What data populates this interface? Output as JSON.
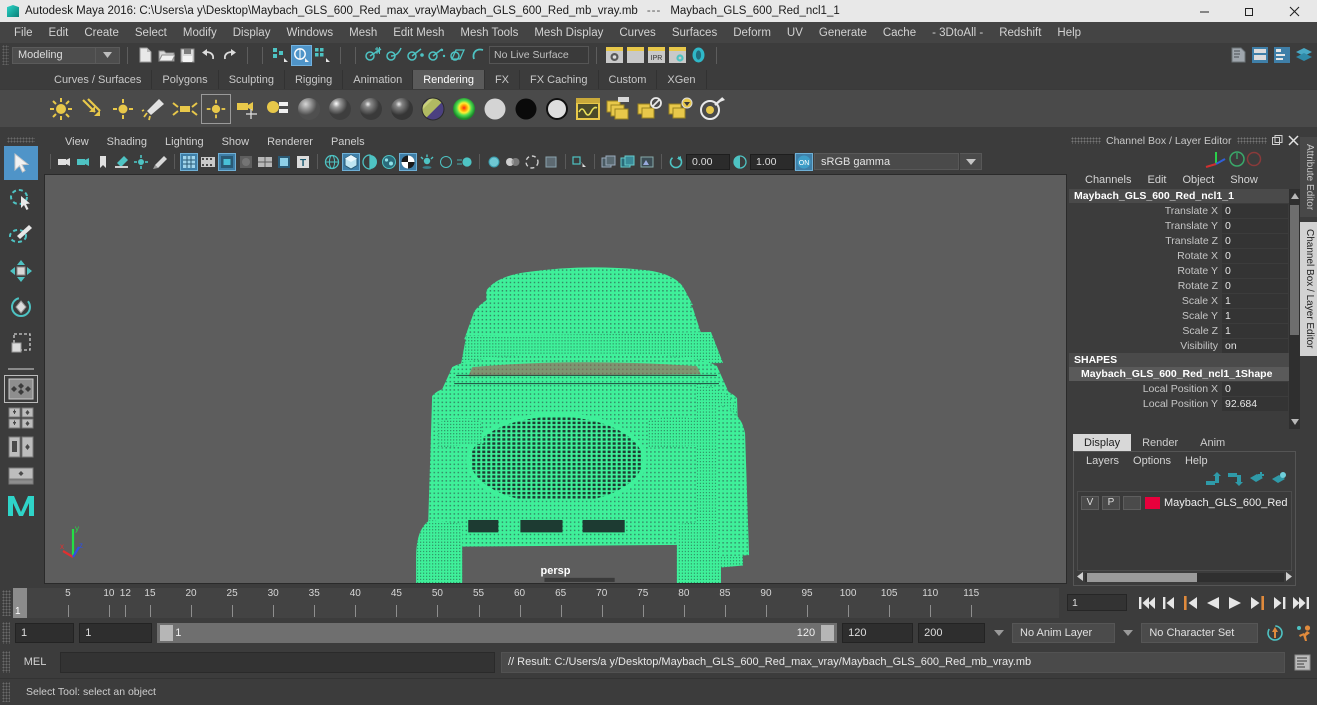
{
  "window": {
    "app_title": "Autodesk Maya 2016: C:\\Users\\a y\\Desktop\\Maybach_GLS_600_Red_max_vray\\Maybach_GLS_600_Red_mb_vray.mb",
    "title_separator": "---",
    "selected_object_title": "Maybach_GLS_600_Red_ncl1_1",
    "minimize": "minimize-icon",
    "maximize": "restore-icon",
    "close": "close-icon"
  },
  "menubar": {
    "items": [
      "File",
      "Edit",
      "Create",
      "Select",
      "Modify",
      "Display",
      "Windows",
      "Mesh",
      "Edit Mesh",
      "Mesh Tools",
      "Mesh Display",
      "Curves",
      "Surfaces",
      "Deform",
      "UV",
      "Generate",
      "Cache",
      "- 3DtoAll -",
      "Redshift",
      "Help"
    ]
  },
  "statusline": {
    "menu_set": "Modeling",
    "live_surface": "No Live Surface",
    "icons": [
      "new-scene-icon",
      "open-scene-icon",
      "save-scene-icon",
      "undo-icon",
      "redo-icon",
      "select-by-hierarchy-icon",
      "select-by-object-icon",
      "select-by-component-icon",
      "snap-to-grid-icon",
      "snap-to-curve-icon",
      "snap-to-point-icon",
      "snap-to-projected-center-icon",
      "snap-to-view-plane-icon",
      "make-live-icon",
      "render-view-icon",
      "render-frame-icon",
      "ipr-render-icon",
      "render-settings-icon",
      "hypershade-icon"
    ],
    "right_icons": [
      "toggle-attribute-editor-icon",
      "toggle-tool-settings-icon",
      "toggle-channel-box-icon",
      "toggle-layer-editor-icon"
    ]
  },
  "shelf": {
    "tabs": [
      "Curves / Surfaces",
      "Polygons",
      "Sculpting",
      "Rigging",
      "Animation",
      "Rendering",
      "FX",
      "FX Caching",
      "Custom",
      "XGen"
    ],
    "active_tab": "Rendering",
    "icons": [
      "ambient-light-icon",
      "directional-light-icon",
      "point-light-icon",
      "spot-light-icon",
      "area-light-icon",
      "volume-light-icon",
      "camera-icon",
      "light-linking-icon",
      "lambert-material-icon",
      "blinn-material-icon",
      "phong-material-icon",
      "phong-e-material-icon",
      "anisotropic-material-icon",
      "layered-shader-icon",
      "ramp-shader-icon",
      "surface-shader-icon",
      "use-background-icon",
      "shading-map-icon",
      "hypershade-window-icon",
      "batch-render-icon",
      "cancel-batch-render-icon",
      "show-batch-render-icon",
      "render-current-frame-icon"
    ]
  },
  "toolbox": {
    "items": [
      {
        "name": "select-tool",
        "selected": true
      },
      {
        "name": "lasso-select-tool",
        "selected": false
      },
      {
        "name": "paint-select-tool",
        "selected": false
      },
      {
        "name": "move-tool",
        "selected": false
      },
      {
        "name": "rotate-tool",
        "selected": false
      },
      {
        "name": "scale-tool",
        "selected": false
      }
    ],
    "layouts": [
      {
        "name": "single-perspective-layout",
        "selected": true
      },
      {
        "name": "four-view-layout",
        "selected": false
      },
      {
        "name": "persp-outliner-layout",
        "selected": false
      },
      {
        "name": "persp-graph-layout",
        "selected": false
      },
      {
        "name": "maya-logo",
        "selected": false
      }
    ]
  },
  "viewport": {
    "menu": [
      "View",
      "Shading",
      "Lighting",
      "Show",
      "Renderer",
      "Panels"
    ],
    "toolbar_icons": [
      "select-camera-icon",
      "lock-camera-icon",
      "bookmark-icon",
      "image-plane-icon",
      "2d-pan-zoom-icon",
      "grease-pencil-icon",
      "grid-icon",
      "film-gate-icon",
      "resolution-gate-icon",
      "gate-mask-icon",
      "field-chart-icon",
      "safe-action-icon",
      "safe-title-icon",
      "wireframe-icon",
      "smooth-shade-all-icon",
      "shade-selected-items-icon",
      "wireframe-on-shaded-icon",
      "texture-icon",
      "use-all-lights-icon",
      "shadows-icon",
      "screen-space-ao-icon",
      "motion-blur-icon",
      "multisample-aa-icon",
      "depth-of-field-icon",
      "isolate-select-icon",
      "xray-icon",
      "xray-joints-icon",
      "xray-active-components-icon",
      "exposure-icon",
      "gamma-icon",
      "view-transform-icon"
    ],
    "exposure_value": "0.00",
    "gamma_value": "1.00",
    "color_transform": "sRGB gamma",
    "camera_label": "persp",
    "axis_labels": {
      "x": "x",
      "y": "y",
      "z": "z"
    },
    "model_description": "maybach-gls-600-wireframe-car-model"
  },
  "channel_box": {
    "panel_title": "Channel Box / Layer Editor",
    "menu": [
      "Channels",
      "Edit",
      "Object",
      "Show"
    ],
    "object_name": "Maybach_GLS_600_Red_ncl1_1",
    "attributes": [
      {
        "label": "Translate X",
        "value": "0"
      },
      {
        "label": "Translate Y",
        "value": "0"
      },
      {
        "label": "Translate Z",
        "value": "0"
      },
      {
        "label": "Rotate X",
        "value": "0"
      },
      {
        "label": "Rotate Y",
        "value": "0"
      },
      {
        "label": "Rotate Z",
        "value": "0"
      },
      {
        "label": "Scale X",
        "value": "1"
      },
      {
        "label": "Scale Y",
        "value": "1"
      },
      {
        "label": "Scale Z",
        "value": "1"
      },
      {
        "label": "Visibility",
        "value": "on"
      }
    ],
    "shapes_header": "SHAPES",
    "shape_name": "Maybach_GLS_600_Red_ncl1_1Shape",
    "shape_attributes": [
      {
        "label": "Local Position X",
        "value": "0"
      },
      {
        "label": "Local Position Y",
        "value": "92.684"
      }
    ]
  },
  "layer_editor": {
    "tabs": [
      "Display",
      "Render",
      "Anim"
    ],
    "active_tab": "Display",
    "menu": [
      "Layers",
      "Options",
      "Help"
    ],
    "toolbar_icons": [
      "move-layer-up-icon",
      "move-layer-down-icon",
      "new-layer-icon",
      "new-layer-from-selected-icon"
    ],
    "layers": [
      {
        "visibility": "V",
        "playback": "P",
        "third": "",
        "color": "#e8003c",
        "name": "Maybach_GLS_600_Red"
      }
    ]
  },
  "timeline": {
    "current_frame": "1",
    "ticks": [
      "5",
      "10",
      "15",
      "20",
      "25",
      "30",
      "35",
      "40",
      "45",
      "50",
      "55",
      "60",
      "65",
      "70",
      "75",
      "80",
      "85",
      "90",
      "95",
      "100",
      "105",
      "110",
      "115",
      "12"
    ],
    "current_frame_field": "1",
    "playback_buttons": [
      "go-to-start-icon",
      "step-back-keyframe-icon",
      "step-back-frame-icon",
      "play-backwards-icon",
      "play-forwards-icon",
      "step-forward-frame-icon",
      "step-forward-keyframe-icon",
      "go-to-end-icon"
    ]
  },
  "range_slider": {
    "anim_start": "1",
    "playback_start": "1",
    "range_start_label": "1",
    "range_end_label": "120",
    "playback_end": "120",
    "anim_end": "200",
    "anim_layer": "No Anim Layer",
    "character_set": "No Character Set",
    "icons": [
      "auto-keyframe-icon",
      "animation-preferences-icon"
    ]
  },
  "command_line": {
    "label": "MEL",
    "input_value": "",
    "result_text": "// Result: C:/Users/a y/Desktop/Maybach_GLS_600_Red_max_vray/Maybach_GLS_600_Red_mb_vray.mb",
    "script_editor_icon": "script-editor-icon"
  },
  "status_bar": {
    "help_text": "Select Tool: select an object"
  },
  "colors": {
    "accent_blue": "#4f94c8",
    "selection_green": "#3ff09a",
    "layer_red": "#e8003c",
    "shelf_yellow": "#e8c84a",
    "teal": "#4ec3c3",
    "viewport_bg": "#5d5d5d"
  }
}
